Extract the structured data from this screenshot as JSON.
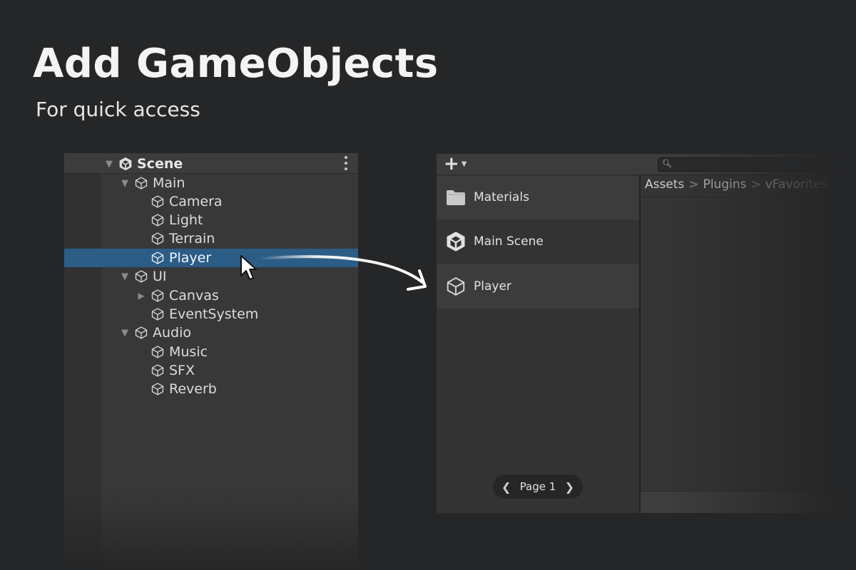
{
  "header": {
    "title": "Add GameObjects",
    "subtitle": "For quick access"
  },
  "hierarchy": {
    "scene_label": "Scene",
    "items": [
      {
        "label": "Main"
      },
      {
        "label": "Camera"
      },
      {
        "label": "Light"
      },
      {
        "label": "Terrain"
      },
      {
        "label": "Player"
      },
      {
        "label": "UI"
      },
      {
        "label": "Canvas"
      },
      {
        "label": "EventSystem"
      },
      {
        "label": "Audio"
      },
      {
        "label": "Music"
      },
      {
        "label": "SFX"
      },
      {
        "label": "Reverb"
      }
    ],
    "selected_item": "Player"
  },
  "favorites": {
    "toolbar": {
      "add_icon": "plus-icon",
      "search_placeholder": ""
    },
    "items": [
      {
        "label": "Materials",
        "icon": "folder-icon"
      },
      {
        "label": "Main Scene",
        "icon": "unity-logo-icon"
      },
      {
        "label": "Player",
        "icon": "cube-icon"
      }
    ],
    "breadcrumb": [
      "Assets",
      "Plugins",
      "vFavorites"
    ],
    "pager": {
      "label": "Page 1"
    }
  },
  "colors": {
    "background": "#252627",
    "panel": "#383838",
    "selection": "#2c5d87"
  }
}
